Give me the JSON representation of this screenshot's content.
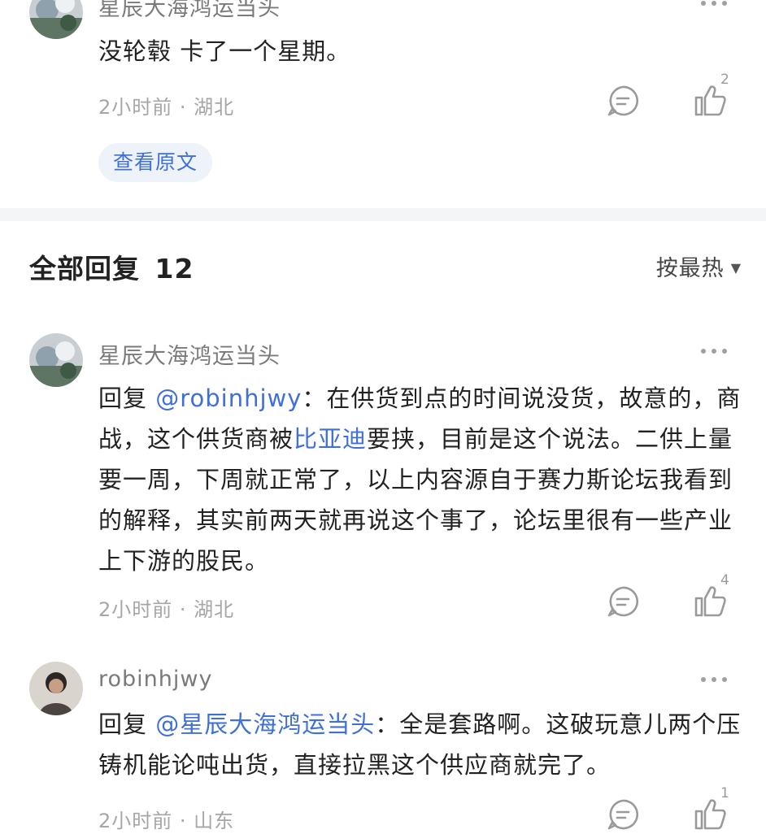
{
  "top_comment": {
    "username": "星辰大海鸿运当头",
    "text": "没轮毂 卡了一个星期。",
    "time": "2小时前",
    "location": "湖北",
    "likes": "2",
    "view_original_label": "查看原文"
  },
  "replies_section": {
    "title": "全部回复",
    "count": "12",
    "sort_label": "按最热",
    "sort_icon": "caret-down-icon"
  },
  "replies": [
    {
      "username": "星辰大海鸿运当头",
      "reply_prefix": "回复 ",
      "mention": "@robinhjwy",
      "text_a": "：在供货到点的时间说没货，故意的，商战，这个供货商被",
      "link": "比亚迪",
      "text_b": "要挟，目前是这个说法。二供上量要一周，下周就正常了，以上内容源自于赛力斯论坛我看到的解释，其实前两天就再说这个事了，论坛里很有一些产业上下游的股民。",
      "time": "2小时前",
      "location": "湖北",
      "likes": "4"
    },
    {
      "username": "robinhjwy",
      "reply_prefix": "回复 ",
      "mention": "@星辰大海鸿运当头",
      "text_a": "：全是套路啊。这破玩意儿两个压铸机能论吨出货，直接拉黑这个供应商就完了。",
      "time": "2小时前",
      "location": "山东",
      "likes": "1"
    }
  ],
  "meta_separator": " · ",
  "colors": {
    "link": "#3f6fd8",
    "muted": "#a6a6a6",
    "divider": "#f4f5f7"
  }
}
